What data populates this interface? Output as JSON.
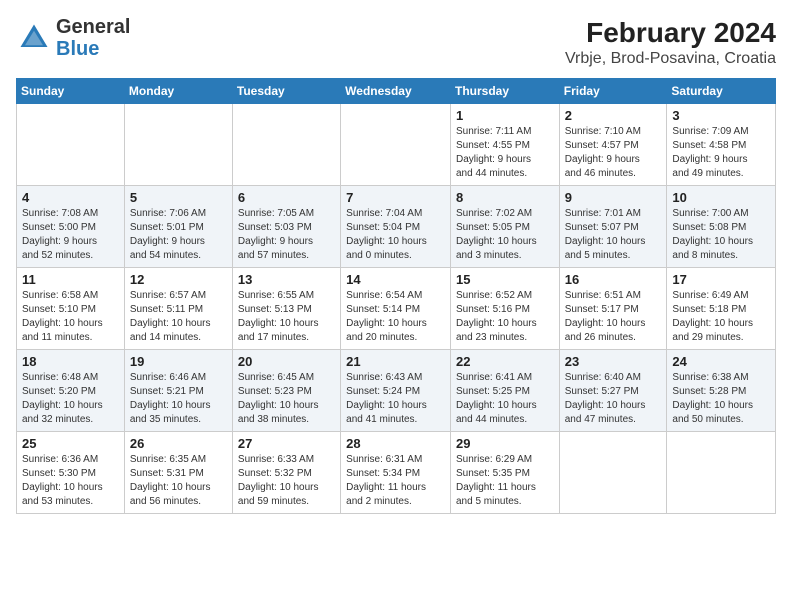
{
  "logo": {
    "text_general": "General",
    "text_blue": "Blue"
  },
  "title": "February 2024",
  "subtitle": "Vrbje, Brod-Posavina, Croatia",
  "days_of_week": [
    "Sunday",
    "Monday",
    "Tuesday",
    "Wednesday",
    "Thursday",
    "Friday",
    "Saturday"
  ],
  "weeks": [
    [
      {
        "day": "",
        "detail": ""
      },
      {
        "day": "",
        "detail": ""
      },
      {
        "day": "",
        "detail": ""
      },
      {
        "day": "",
        "detail": ""
      },
      {
        "day": "1",
        "detail": "Sunrise: 7:11 AM\nSunset: 4:55 PM\nDaylight: 9 hours\nand 44 minutes."
      },
      {
        "day": "2",
        "detail": "Sunrise: 7:10 AM\nSunset: 4:57 PM\nDaylight: 9 hours\nand 46 minutes."
      },
      {
        "day": "3",
        "detail": "Sunrise: 7:09 AM\nSunset: 4:58 PM\nDaylight: 9 hours\nand 49 minutes."
      }
    ],
    [
      {
        "day": "4",
        "detail": "Sunrise: 7:08 AM\nSunset: 5:00 PM\nDaylight: 9 hours\nand 52 minutes."
      },
      {
        "day": "5",
        "detail": "Sunrise: 7:06 AM\nSunset: 5:01 PM\nDaylight: 9 hours\nand 54 minutes."
      },
      {
        "day": "6",
        "detail": "Sunrise: 7:05 AM\nSunset: 5:03 PM\nDaylight: 9 hours\nand 57 minutes."
      },
      {
        "day": "7",
        "detail": "Sunrise: 7:04 AM\nSunset: 5:04 PM\nDaylight: 10 hours\nand 0 minutes."
      },
      {
        "day": "8",
        "detail": "Sunrise: 7:02 AM\nSunset: 5:05 PM\nDaylight: 10 hours\nand 3 minutes."
      },
      {
        "day": "9",
        "detail": "Sunrise: 7:01 AM\nSunset: 5:07 PM\nDaylight: 10 hours\nand 5 minutes."
      },
      {
        "day": "10",
        "detail": "Sunrise: 7:00 AM\nSunset: 5:08 PM\nDaylight: 10 hours\nand 8 minutes."
      }
    ],
    [
      {
        "day": "11",
        "detail": "Sunrise: 6:58 AM\nSunset: 5:10 PM\nDaylight: 10 hours\nand 11 minutes."
      },
      {
        "day": "12",
        "detail": "Sunrise: 6:57 AM\nSunset: 5:11 PM\nDaylight: 10 hours\nand 14 minutes."
      },
      {
        "day": "13",
        "detail": "Sunrise: 6:55 AM\nSunset: 5:13 PM\nDaylight: 10 hours\nand 17 minutes."
      },
      {
        "day": "14",
        "detail": "Sunrise: 6:54 AM\nSunset: 5:14 PM\nDaylight: 10 hours\nand 20 minutes."
      },
      {
        "day": "15",
        "detail": "Sunrise: 6:52 AM\nSunset: 5:16 PM\nDaylight: 10 hours\nand 23 minutes."
      },
      {
        "day": "16",
        "detail": "Sunrise: 6:51 AM\nSunset: 5:17 PM\nDaylight: 10 hours\nand 26 minutes."
      },
      {
        "day": "17",
        "detail": "Sunrise: 6:49 AM\nSunset: 5:18 PM\nDaylight: 10 hours\nand 29 minutes."
      }
    ],
    [
      {
        "day": "18",
        "detail": "Sunrise: 6:48 AM\nSunset: 5:20 PM\nDaylight: 10 hours\nand 32 minutes."
      },
      {
        "day": "19",
        "detail": "Sunrise: 6:46 AM\nSunset: 5:21 PM\nDaylight: 10 hours\nand 35 minutes."
      },
      {
        "day": "20",
        "detail": "Sunrise: 6:45 AM\nSunset: 5:23 PM\nDaylight: 10 hours\nand 38 minutes."
      },
      {
        "day": "21",
        "detail": "Sunrise: 6:43 AM\nSunset: 5:24 PM\nDaylight: 10 hours\nand 41 minutes."
      },
      {
        "day": "22",
        "detail": "Sunrise: 6:41 AM\nSunset: 5:25 PM\nDaylight: 10 hours\nand 44 minutes."
      },
      {
        "day": "23",
        "detail": "Sunrise: 6:40 AM\nSunset: 5:27 PM\nDaylight: 10 hours\nand 47 minutes."
      },
      {
        "day": "24",
        "detail": "Sunrise: 6:38 AM\nSunset: 5:28 PM\nDaylight: 10 hours\nand 50 minutes."
      }
    ],
    [
      {
        "day": "25",
        "detail": "Sunrise: 6:36 AM\nSunset: 5:30 PM\nDaylight: 10 hours\nand 53 minutes."
      },
      {
        "day": "26",
        "detail": "Sunrise: 6:35 AM\nSunset: 5:31 PM\nDaylight: 10 hours\nand 56 minutes."
      },
      {
        "day": "27",
        "detail": "Sunrise: 6:33 AM\nSunset: 5:32 PM\nDaylight: 10 hours\nand 59 minutes."
      },
      {
        "day": "28",
        "detail": "Sunrise: 6:31 AM\nSunset: 5:34 PM\nDaylight: 11 hours\nand 2 minutes."
      },
      {
        "day": "29",
        "detail": "Sunrise: 6:29 AM\nSunset: 5:35 PM\nDaylight: 11 hours\nand 5 minutes."
      },
      {
        "day": "",
        "detail": ""
      },
      {
        "day": "",
        "detail": ""
      }
    ]
  ]
}
